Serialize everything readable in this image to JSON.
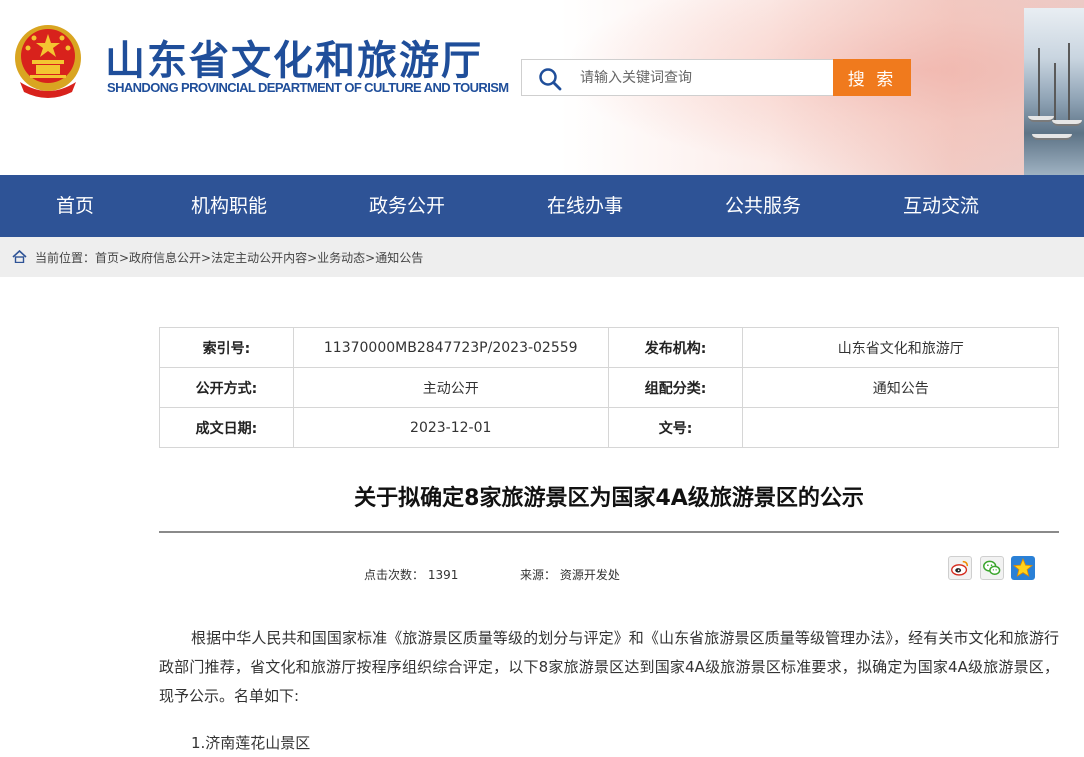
{
  "header": {
    "title": "山东省文化和旅游厅",
    "subtitle": "SHANDONG PROVINCIAL DEPARTMENT OF CULTURE AND TOURISM",
    "search_placeholder": "请输入关键词查询",
    "search_button": "搜 索"
  },
  "nav": {
    "items": [
      "首页",
      "机构职能",
      "政务公开",
      "在线办事",
      "公共服务",
      "互动交流"
    ]
  },
  "breadcrumb": {
    "text": "当前位置：首页>政府信息公开>法定主动公开内容>业务动态>通知公告"
  },
  "meta": {
    "index_label": "索引号:",
    "index_value": "11370000MB2847723P/2023-02559",
    "publisher_label": "发布机构:",
    "publisher_value": "山东省文化和旅游厅",
    "open_mode_label": "公开方式:",
    "open_mode_value": "主动公开",
    "category_label": "组配分类:",
    "category_value": "通知公告",
    "date_label": "成文日期:",
    "date_value": "2023-12-01",
    "doc_no_label": "文号:",
    "doc_no_value": ""
  },
  "article": {
    "title": "关于拟确定8家旅游景区为国家4A级旅游景区的公示",
    "views_label": "点击次数：",
    "views": "1391",
    "source_label": "来源：",
    "source": "资源开发处",
    "body": "根据中华人民共和国国家标准《旅游景区质量等级的划分与评定》和《山东省旅游景区质量等级管理办法》，经有关市文化和旅游行政部门推荐，省文化和旅游厅按程序组织综合评定，以下8家旅游景区达到国家4A级旅游景区标准要求，拟确定为国家4A级旅游景区，现予公示。名单如下:",
    "list_first": "1.济南莲花山景区"
  },
  "share_icons": [
    "weibo-icon",
    "wechat-icon",
    "qzone-icon"
  ],
  "colors": {
    "brand_blue": "#1f4e9a",
    "nav_blue": "#2e5396",
    "search_orange": "#f07a1d"
  }
}
